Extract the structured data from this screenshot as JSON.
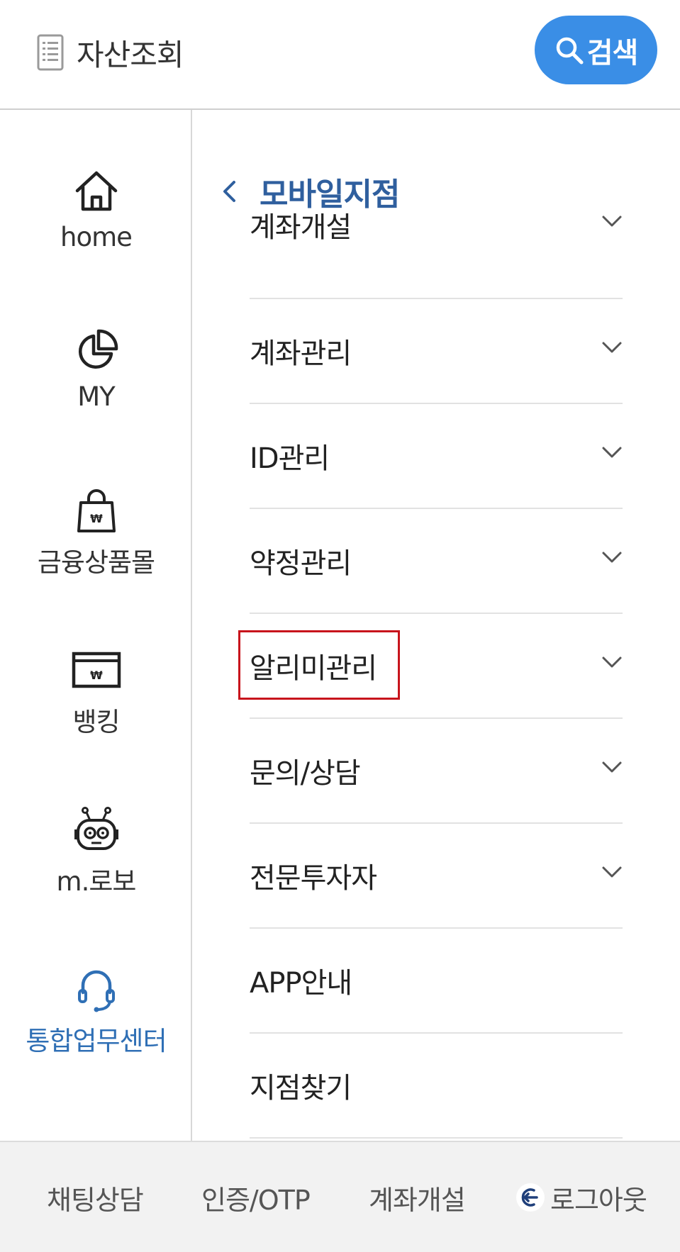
{
  "header": {
    "asset_label": "자산조회",
    "search_label": "검색"
  },
  "left_nav": {
    "items": [
      {
        "label": "home",
        "icon": "home-icon"
      },
      {
        "label": "MY",
        "icon": "pie-chart-icon"
      },
      {
        "label": "금융상품몰",
        "icon": "shopping-bag-icon"
      },
      {
        "label": "뱅킹",
        "icon": "banking-icon"
      },
      {
        "label": "m.로보",
        "icon": "robot-icon"
      },
      {
        "label": "통합업무센터",
        "icon": "headset-icon",
        "active": true
      }
    ]
  },
  "main": {
    "breadcrumb": "모바일지점",
    "menu": [
      {
        "label": "계좌개설",
        "has_submenu": true
      },
      {
        "label": "계좌관리",
        "has_submenu": true
      },
      {
        "label": "ID관리",
        "has_submenu": true
      },
      {
        "label": "약정관리",
        "has_submenu": true
      },
      {
        "label": "알리미관리",
        "has_submenu": true
      },
      {
        "label": "문의/상담",
        "has_submenu": true
      },
      {
        "label": "전문투자자",
        "has_submenu": true
      },
      {
        "label": "APP안내",
        "has_submenu": false
      },
      {
        "label": "지점찾기",
        "has_submenu": false
      }
    ]
  },
  "footer": {
    "items": [
      {
        "label": "채팅상담"
      },
      {
        "label": "인증/OTP"
      },
      {
        "label": "계좌개설"
      },
      {
        "label": "로그아웃",
        "icon": "logout-icon"
      }
    ]
  },
  "colors": {
    "accent": "#3a8ee6",
    "active_nav": "#2f6fb5",
    "breadcrumb": "#2f5f9e",
    "highlight_box": "#c8141c",
    "footer_bg": "#f2f2f2"
  }
}
